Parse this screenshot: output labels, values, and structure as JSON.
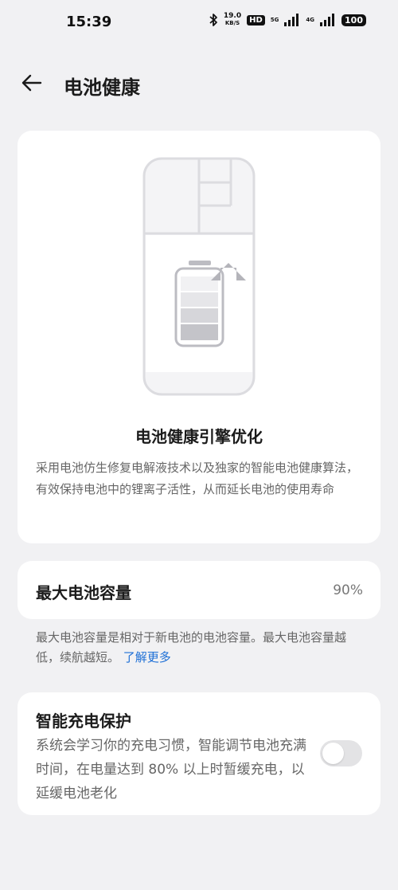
{
  "status_bar": {
    "time": "15:39",
    "net_speed_value": "19.0",
    "net_speed_unit": "KB/S",
    "hd_label": "HD",
    "sim1_label": "5G",
    "sim2_label": "4G",
    "battery_level": "100"
  },
  "header": {
    "title": "电池健康"
  },
  "hero": {
    "title": "电池健康引擎优化",
    "description": "采用电池仿生修复电解液技术以及独家的智能电池健康算法，有效保持电池中的锂离子活性，从而延长电池的使用寿命"
  },
  "capacity": {
    "label": "最大电池容量",
    "value": "90%"
  },
  "capacity_note": {
    "text": "最大电池容量是相对于新电池的电池容量。最大电池容量越低，续航越短。",
    "link": "了解更多"
  },
  "smart_charging": {
    "title": "智能充电保护",
    "description": "系统会学习你的充电习惯，智能调节电池充满时间，在电量达到 80% 以上时暂缓充电，以延缓电池老化",
    "enabled": false
  }
}
